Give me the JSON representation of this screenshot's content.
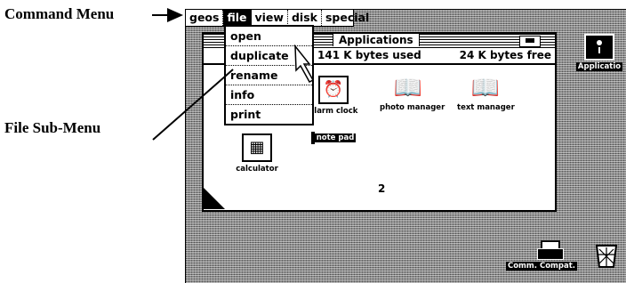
{
  "annotations": {
    "command_menu": "Command Menu",
    "file_sub_menu": "File Sub-Menu"
  },
  "menu_bar": [
    "geos",
    "file",
    "view",
    "disk",
    "special"
  ],
  "active_menu": "file",
  "file_menu": [
    "open",
    "duplicate",
    "rename",
    "info",
    "print"
  ],
  "window": {
    "title": "Applications",
    "used": "141 K bytes used",
    "free": "24 K bytes free",
    "page_number": "2"
  },
  "window_icons": [
    {
      "name": "alarm clock",
      "icon": "alarm-clock-icon"
    },
    {
      "name": "photo manager",
      "icon": "photo-manager-icon"
    },
    {
      "name": "text manager",
      "icon": "text-manager-icon"
    },
    {
      "name": "calculator",
      "icon": "calculator-icon"
    },
    {
      "name": "note pad",
      "icon": "note-pad-icon",
      "selected": true
    }
  ],
  "desktop": {
    "disk_label": "Applicatio",
    "printer_label": "Comm. Compat."
  }
}
